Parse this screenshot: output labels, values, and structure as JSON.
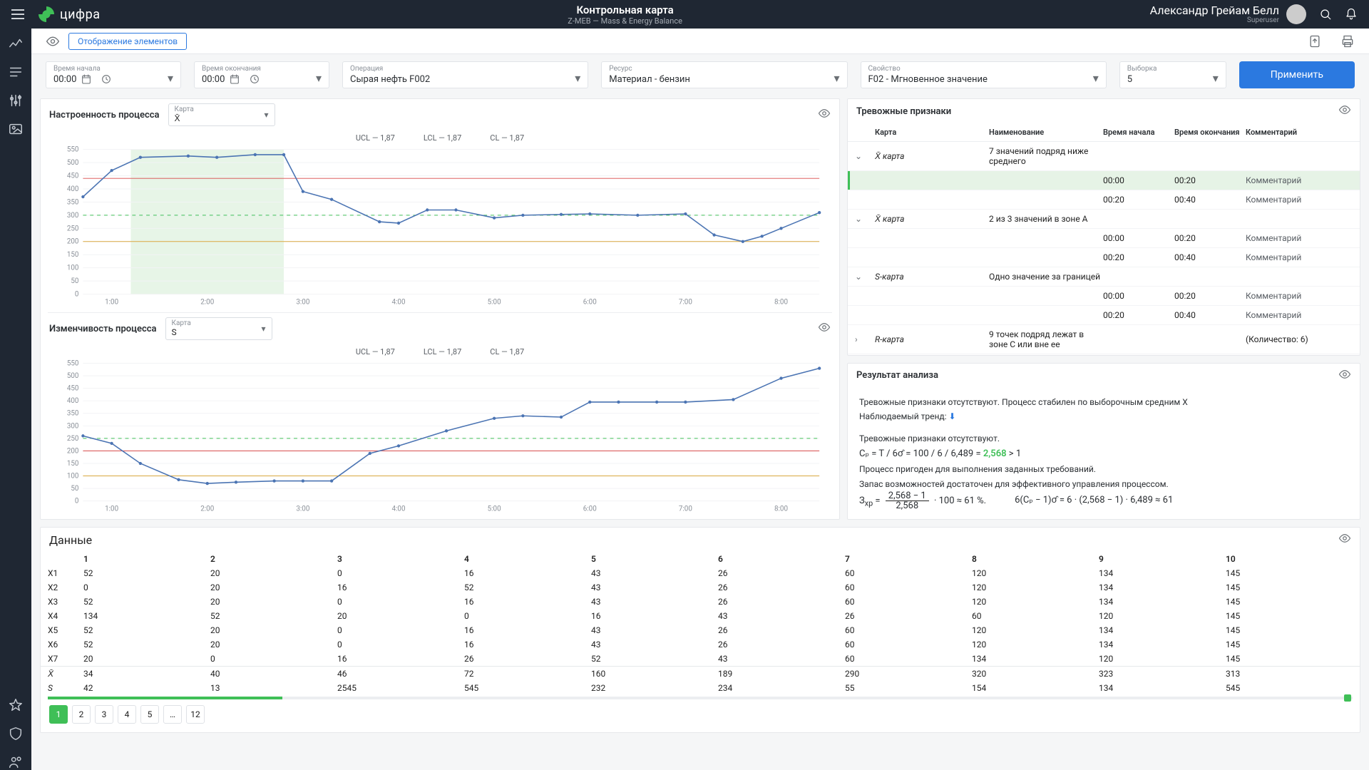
{
  "app": {
    "brand": "цифра",
    "title": "Контрольная карта",
    "subtitle": "Z-MEB — Mass & Energy Balance"
  },
  "user": {
    "name": "Александр Грейам Белл",
    "role": "Superuser"
  },
  "toolstrip": {
    "display_elements": "Отображение элементов"
  },
  "filters": {
    "start": {
      "label": "Время начала",
      "value": "00:00"
    },
    "end": {
      "label": "Время окончания",
      "value": "00:00"
    },
    "operation": {
      "label": "Операция",
      "value": "Сырая нефть F002"
    },
    "resource": {
      "label": "Ресурс",
      "value": "Материал - бензин"
    },
    "property": {
      "label": "Свойство",
      "value": "F02 - Мгновенное значение"
    },
    "sample": {
      "label": "Выборка",
      "value": "5"
    },
    "apply": "Применить"
  },
  "chart1": {
    "title": "Настроенность процесса",
    "card_label": "Карта",
    "card_value": "X̄",
    "ucl": "UCL — 1,87",
    "lcl": "LCL — 1,87",
    "cl": "CL — 1,87"
  },
  "chart2": {
    "title": "Изменчивость процесса",
    "card_label": "Карта",
    "card_value": "S",
    "ucl": "UCL — 1,87",
    "lcl": "LCL — 1,87",
    "cl": "CL — 1,87"
  },
  "chart_data": [
    {
      "type": "line",
      "title": "Настроенность процесса",
      "xlabel": "",
      "ylabel": "",
      "ylim": [
        0,
        550
      ],
      "y_ticks": [
        0,
        50,
        100,
        150,
        200,
        250,
        300,
        350,
        400,
        450,
        500,
        550
      ],
      "x_labels": [
        "1:00",
        "2:00",
        "3:00",
        "4:00",
        "5:00",
        "6:00",
        "7:00",
        "8:00"
      ],
      "ucl_y": 440,
      "lcl_y": 200,
      "cl_y": 300,
      "highlight_x": [
        1.2,
        2.8
      ],
      "series": [
        {
          "name": "X̄",
          "x": [
            0.7,
            1.0,
            1.3,
            1.8,
            2.1,
            2.5,
            2.8,
            3.0,
            3.3,
            3.8,
            4.0,
            4.3,
            4.6,
            5.0,
            5.3,
            5.7,
            6.0,
            6.5,
            7.0,
            7.3,
            7.6,
            7.8,
            8.0,
            8.4
          ],
          "y": [
            370,
            470,
            520,
            525,
            520,
            530,
            530,
            390,
            360,
            275,
            270,
            320,
            320,
            290,
            300,
            303,
            305,
            300,
            305,
            225,
            200,
            220,
            250,
            310
          ]
        }
      ]
    },
    {
      "type": "line",
      "title": "Изменчивость процесса",
      "xlabel": "",
      "ylabel": "",
      "ylim": [
        0,
        550
      ],
      "y_ticks": [
        0,
        50,
        100,
        150,
        200,
        250,
        300,
        350,
        400,
        450,
        500,
        550
      ],
      "x_labels": [
        "1:00",
        "2:00",
        "3:00",
        "4:00",
        "5:00",
        "6:00",
        "7:00",
        "8:00"
      ],
      "ucl_y": 200,
      "lcl_y": 100,
      "cl_y": 250,
      "series": [
        {
          "name": "S",
          "x": [
            0.7,
            1.0,
            1.3,
            1.7,
            2.0,
            2.3,
            2.7,
            3.0,
            3.3,
            3.7,
            4.0,
            4.5,
            5.0,
            5.3,
            5.7,
            6.0,
            6.3,
            6.7,
            7.0,
            7.5,
            8.0,
            8.4
          ],
          "y": [
            260,
            230,
            150,
            85,
            70,
            75,
            80,
            80,
            80,
            190,
            220,
            280,
            330,
            340,
            335,
            395,
            395,
            395,
            395,
            405,
            490,
            530
          ]
        }
      ]
    }
  ],
  "alarms": {
    "title": "Тревожные признаки",
    "headers": {
      "card": "Карта",
      "name": "Наименование",
      "start": "Время начала",
      "end": "Время окончания",
      "comment": "Комментарий"
    },
    "groups": [
      {
        "open": true,
        "card": "X̄  карта",
        "name": "7 значений подряд ниже среднего",
        "rows": [
          {
            "start": "00:00",
            "end": "00:20",
            "comment": "Комментарий",
            "sel": true
          },
          {
            "start": "00:20",
            "end": "00:40",
            "comment": "Комментарий"
          }
        ]
      },
      {
        "open": true,
        "card": "X̄  карта",
        "name": "2 из 3 значений в зоне A",
        "rows": [
          {
            "start": "00:00",
            "end": "00:20",
            "comment": "Комментарий"
          },
          {
            "start": "00:20",
            "end": "00:40",
            "comment": "Комментарий"
          }
        ]
      },
      {
        "open": true,
        "card": "S-карта",
        "name": "Одно значение за границей",
        "rows": [
          {
            "start": "00:00",
            "end": "00:20",
            "comment": "Комментарий"
          },
          {
            "start": "00:20",
            "end": "00:40",
            "comment": "Комментарий"
          }
        ]
      },
      {
        "open": false,
        "card": "R-карта",
        "name": "9 точек подряд лежат в зоне C или вне ее",
        "count": "(Количество: 6)",
        "rows": []
      }
    ]
  },
  "analysis": {
    "title": "Результат анализа",
    "line1": "Тревожные признаки отсутствуют. Процесс стабилен по выборочным средним X",
    "trend_label": "Наблюдаемый тренд:",
    "line2": "Тревожные признаки отсутствуют.",
    "formula1_pre": "Cₚ = T / 6σ̂ = 100 / 6 / 6,489 = ",
    "formula1_em": "2,568",
    "formula1_post": " > 1",
    "line3": "Процесс пригоден для выполнения заданных требований.",
    "line4": "Запас возможностей достаточен для эффективного управления процессом.",
    "f2_top": "2,568 − 1",
    "f2_bot": "2,568",
    "f2_rest": " · 100 ≈ 61 %.",
    "f3": "6(Cₚ − 1)σ̂ = 6 · (2,568 − 1) · 6,489 ≈ 61"
  },
  "data": {
    "title": "Данные",
    "cols": [
      "1",
      "2",
      "3",
      "4",
      "5",
      "6",
      "7",
      "8",
      "9",
      "10"
    ],
    "rows": [
      {
        "lbl": "X1",
        "v": [
          52,
          20,
          0,
          16,
          43,
          26,
          60,
          120,
          134,
          145
        ]
      },
      {
        "lbl": "X2",
        "v": [
          0,
          20,
          16,
          52,
          43,
          26,
          60,
          120,
          134,
          145
        ]
      },
      {
        "lbl": "X3",
        "v": [
          52,
          20,
          0,
          16,
          43,
          26,
          60,
          120,
          134,
          145
        ]
      },
      {
        "lbl": "X4",
        "v": [
          134,
          52,
          20,
          0,
          16,
          43,
          26,
          60,
          120,
          145
        ]
      },
      {
        "lbl": "X5",
        "v": [
          52,
          20,
          0,
          16,
          43,
          26,
          60,
          120,
          134,
          145
        ]
      },
      {
        "lbl": "X6",
        "v": [
          52,
          20,
          0,
          16,
          43,
          26,
          60,
          120,
          134,
          145
        ]
      },
      {
        "lbl": "X7",
        "v": [
          20,
          0,
          16,
          26,
          52,
          43,
          60,
          134,
          120,
          145
        ]
      }
    ],
    "summary": [
      {
        "lbl": "X̄",
        "v": [
          34,
          40,
          46,
          72,
          160,
          189,
          290,
          320,
          323,
          313
        ]
      },
      {
        "lbl": "S",
        "v": [
          42,
          13,
          2545,
          545,
          232,
          234,
          55,
          154,
          134,
          545
        ]
      }
    ],
    "pages": [
      "1",
      "2",
      "3",
      "4",
      "5",
      "…",
      "12"
    ]
  }
}
